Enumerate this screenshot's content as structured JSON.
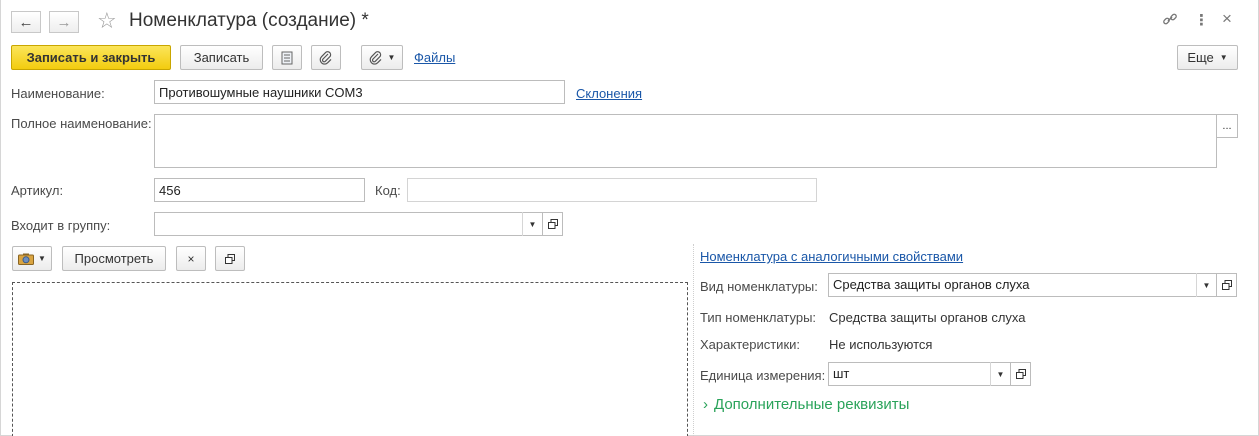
{
  "window": {
    "title": "Номенклатура (создание) *",
    "nav_back_icon": "arrow-left-icon",
    "nav_forward_icon": "arrow-right-icon"
  },
  "toolbar": {
    "save_close_label": "Записать и закрыть",
    "save_label": "Записать",
    "files_label": "Файлы",
    "more_label": "Еще"
  },
  "form": {
    "name_label": "Наименование:",
    "name_value": "Противошумные наушники COM3",
    "declension_link": "Склонения",
    "full_name_label": "Полное наименование:",
    "full_name_value": "",
    "full_name_more": "...",
    "article_label": "Артикул:",
    "article_value": "456",
    "code_label": "Код:",
    "code_value": "",
    "group_label": "Входит в группу:",
    "group_value": ""
  },
  "image_panel": {
    "view_label": "Просмотреть",
    "clear_label": "×"
  },
  "properties": {
    "similar_link": "Номенклатура с аналогичными свойствами",
    "kind_label": "Вид номенклатуры:",
    "kind_value": "Средства защиты органов слуха",
    "type_label": "Тип номенклатуры:",
    "type_value": "Средства защиты органов слуха",
    "characteristics_label": "Характеристики:",
    "characteristics_value": "Не используются",
    "unit_label": "Единица измерения:",
    "unit_value": "шт",
    "additional_label": "Дополнительные реквизиты"
  },
  "colors": {
    "primary_button": "#f3cc0f",
    "link": "#1a57a8",
    "section_green": "#2aa35a"
  }
}
